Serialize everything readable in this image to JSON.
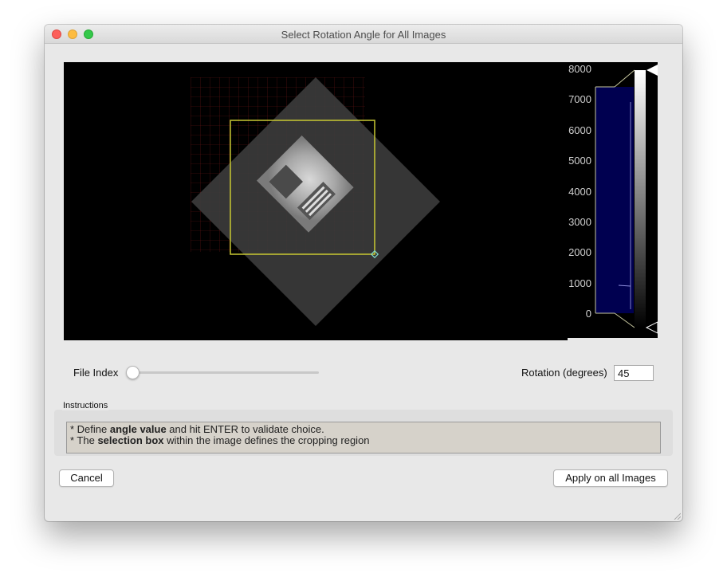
{
  "window": {
    "title": "Select Rotation Angle for All Images"
  },
  "controls": {
    "file_index_label": "File Index",
    "file_index_value": 0,
    "rotation_label": "Rotation (degrees)",
    "rotation_value": "45"
  },
  "colorbar": {
    "ticks": [
      "8000",
      "7000",
      "6000",
      "5000",
      "4000",
      "3000",
      "2000",
      "1000",
      "0"
    ]
  },
  "instructions": {
    "title": "Instructions",
    "line1": {
      "prefix": "* Define ",
      "bold": "angle value",
      "suffix": " and hit ENTER to validate choice."
    },
    "line2": {
      "prefix": "* The ",
      "bold": "selection box",
      "suffix": " within the image defines the cropping region"
    }
  },
  "buttons": {
    "cancel": "Cancel",
    "apply": "Apply on all Images"
  },
  "colors": {
    "selection_box": "#c8c832",
    "grid": "#8b1a1a",
    "histogram": "#000050"
  }
}
